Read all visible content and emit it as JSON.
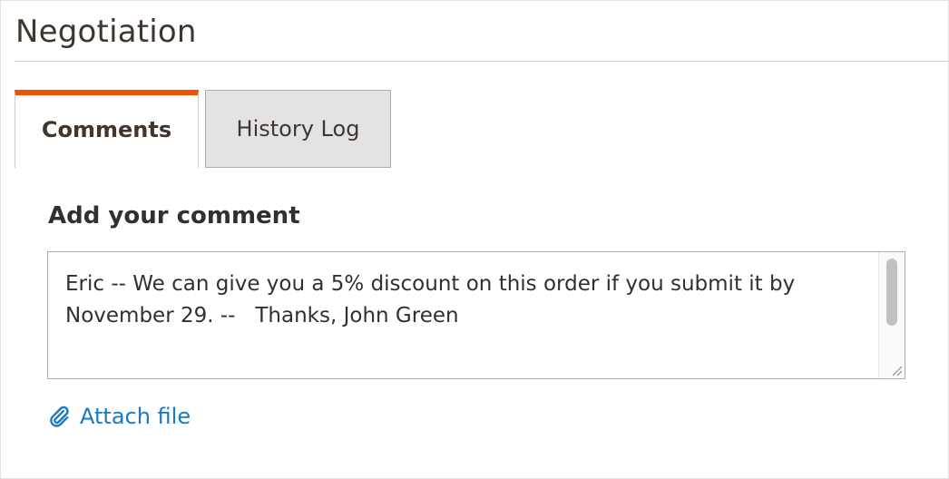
{
  "section": {
    "title": "Negotiation"
  },
  "tabs": [
    {
      "label": "Comments",
      "active": true
    },
    {
      "label": "History Log",
      "active": false
    }
  ],
  "comment": {
    "heading": "Add your comment",
    "value": "Eric -- We can give you a 5% discount on this order if you submit it by November 29. --   Thanks, John Green"
  },
  "attach": {
    "label": "Attach file",
    "icon": "paperclip-icon"
  },
  "colors": {
    "accent": "#eb5202",
    "link": "#1979c3",
    "inactive_tab_bg": "#e3e3e3"
  }
}
